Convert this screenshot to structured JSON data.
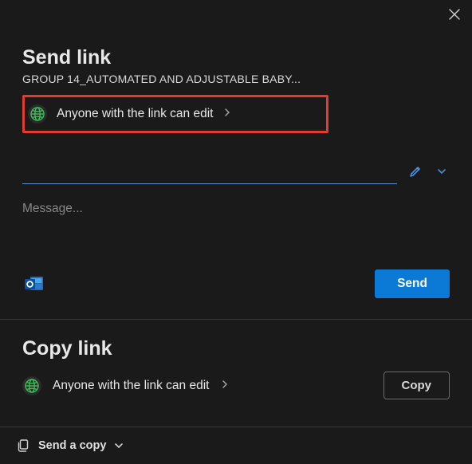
{
  "header": {
    "title": "Send link",
    "subtitle": "GROUP 14_AUTOMATED AND ADJUSTABLE BABY..."
  },
  "permission": {
    "text": "Anyone with the link can edit"
  },
  "recipients": {
    "placeholder": ""
  },
  "message": {
    "placeholder": "Message..."
  },
  "actions": {
    "send": "Send",
    "copy": "Copy"
  },
  "copySection": {
    "title": "Copy link",
    "permission": "Anyone with the link can edit"
  },
  "footer": {
    "label": "Send a copy"
  }
}
